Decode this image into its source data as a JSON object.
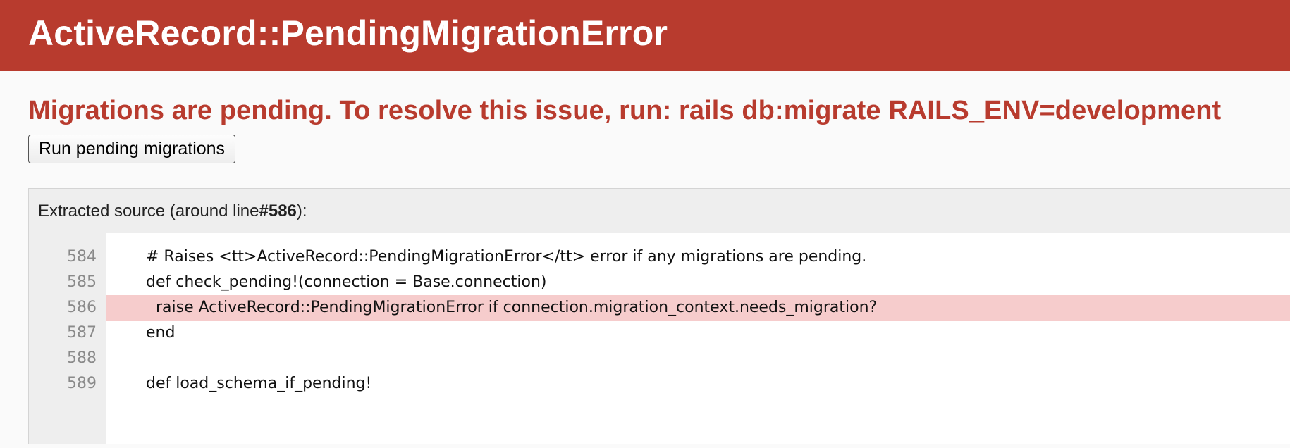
{
  "header": {
    "title": "ActiveRecord::PendingMigrationError"
  },
  "main": {
    "message": "Migrations are pending. To resolve this issue, run: rails db:migrate RAILS_ENV=development",
    "run_button_label": "Run pending migrations"
  },
  "source": {
    "header_prefix": "Extracted source (around line ",
    "header_line": "#586",
    "header_suffix": "):",
    "lines": [
      {
        "number": "584",
        "code": "# Raises <tt>ActiveRecord::PendingMigrationError</tt> error if any migrations are pending."
      },
      {
        "number": "585",
        "code": "def check_pending!(connection = Base.connection)"
      },
      {
        "number": "586",
        "code": "  raise ActiveRecord::PendingMigrationError if connection.migration_context.needs_migration?"
      },
      {
        "number": "587",
        "code": "end"
      },
      {
        "number": "588",
        "code": ""
      },
      {
        "number": "589",
        "code": "def load_schema_if_pending!"
      }
    ],
    "highlighted_line": "586"
  },
  "colors": {
    "header_background": "#b83b2e",
    "error_text": "#b83b2e",
    "highlight_background": "#f6cccc"
  }
}
